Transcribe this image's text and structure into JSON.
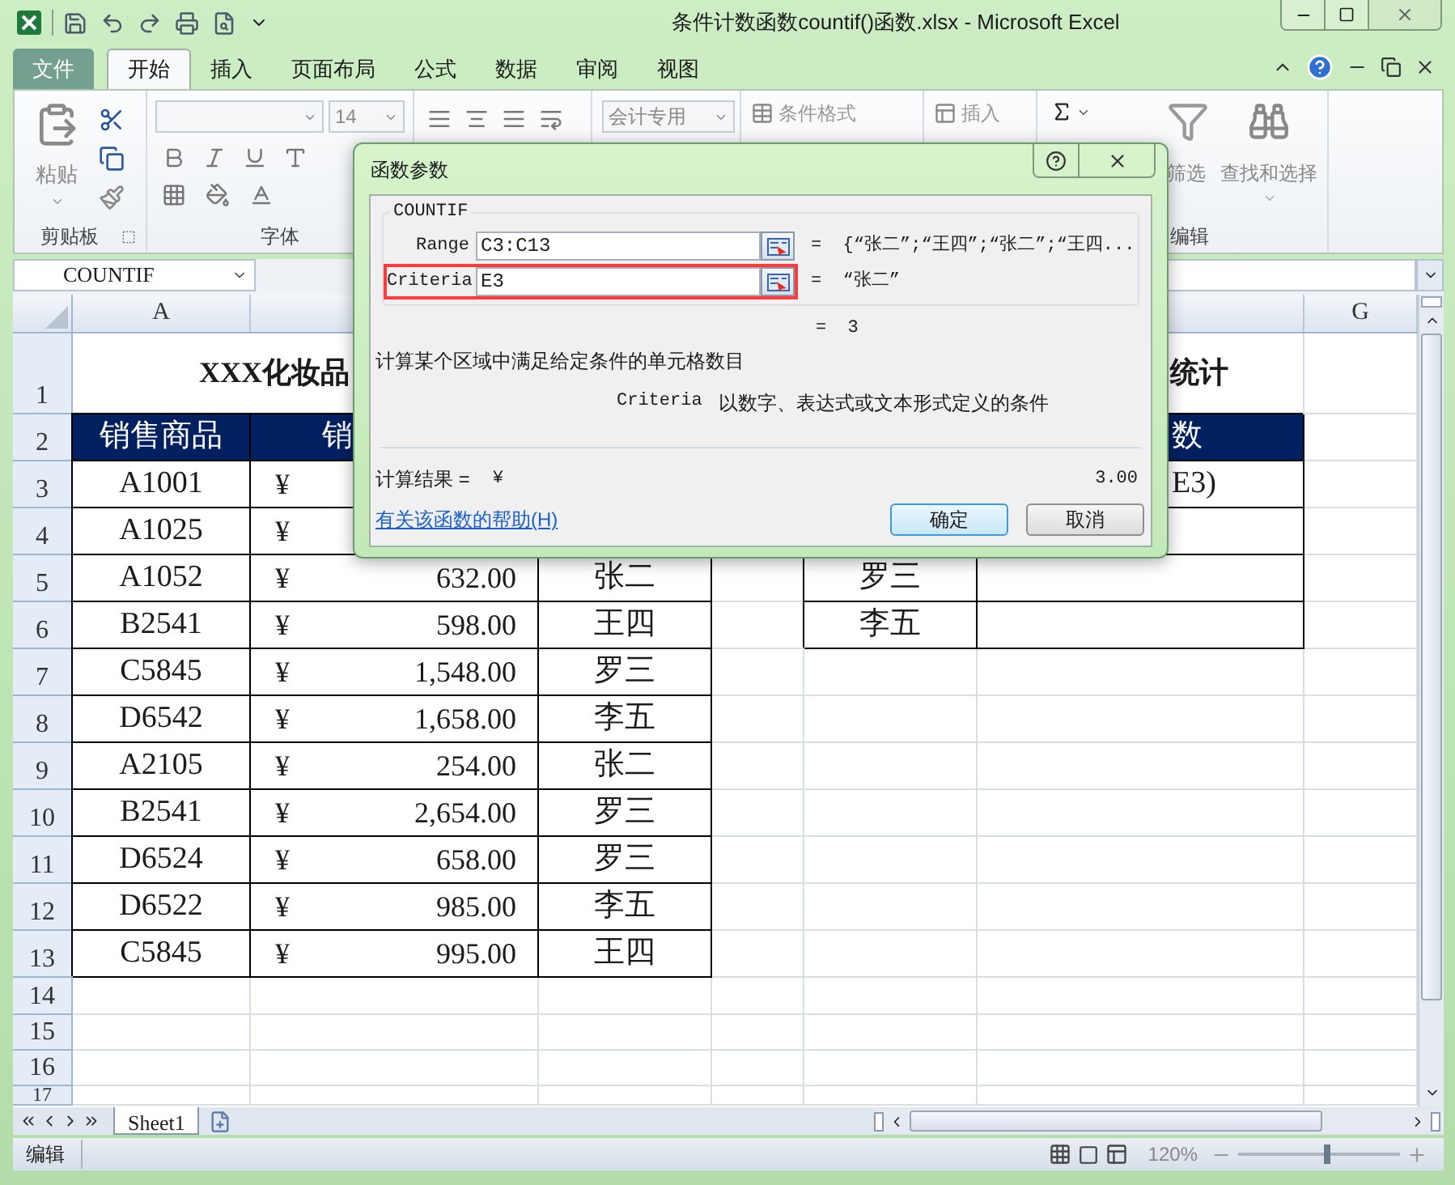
{
  "window": {
    "title": "条件计数函数countif()函数.xlsx  -  Microsoft Excel"
  },
  "ribbon_tabs": [
    {
      "label": "文件",
      "kind": "file",
      "selected": false
    },
    {
      "label": "开始",
      "selected": true
    },
    {
      "label": "插入",
      "selected": false
    },
    {
      "label": "页面布局",
      "selected": false
    },
    {
      "label": "公式",
      "selected": false
    },
    {
      "label": "数据",
      "selected": false
    },
    {
      "label": "审阅",
      "selected": false
    },
    {
      "label": "视图",
      "selected": false
    }
  ],
  "ribbon": {
    "paste_label": "粘贴",
    "clipboard_group": "剪贴板",
    "font_size": "14",
    "font_group": "字体",
    "number_format": "会计专用",
    "conditional_format": "条件格式",
    "insert": "插入",
    "sort_filter": "筛选",
    "find_select": "查找和选择",
    "editing_group": "编辑"
  },
  "formula_bar": {
    "name_box": "COUNTIF"
  },
  "sheet": {
    "column_headers": [
      {
        "label": "A",
        "kind": "first"
      },
      {
        "label": "G",
        "kind": "last"
      }
    ],
    "rows": [
      {
        "number": "1",
        "kind": "title",
        "texts": [
          "XXX化妆品",
          "统计"
        ]
      },
      {
        "number": "2",
        "cells": [
          {
            "text": "销售商品",
            "kind": "header"
          },
          {
            "text": "销",
            "kind": "header"
          },
          null,
          null,
          null,
          {
            "text": "数",
            "kind": "header"
          },
          null
        ]
      },
      {
        "number": "3",
        "cells": [
          {
            "text": "A1001",
            "kind": "text"
          },
          {
            "kind": "currency",
            "symbol": "¥"
          },
          null,
          null,
          null,
          {
            "text": "E3)",
            "kind": "text"
          },
          null
        ]
      },
      {
        "number": "4",
        "cells": [
          {
            "text": "A1025",
            "kind": "text"
          },
          {
            "kind": "currency",
            "symbol": "¥"
          },
          null,
          null,
          null,
          {
            "kind": "text"
          },
          null
        ]
      },
      {
        "number": "5",
        "cells": [
          {
            "text": "A1052",
            "kind": "text"
          },
          {
            "kind": "currency",
            "symbol": "¥",
            "amount": "632.00"
          },
          {
            "text": "张二",
            "kind": "text"
          },
          null,
          {
            "text": "罗三",
            "kind": "text"
          },
          {
            "kind": "text"
          },
          null
        ]
      },
      {
        "number": "6",
        "cells": [
          {
            "text": "B2541",
            "kind": "text"
          },
          {
            "kind": "currency",
            "symbol": "¥",
            "amount": "598.00"
          },
          {
            "text": "王四",
            "kind": "text"
          },
          null,
          {
            "text": "李五",
            "kind": "text"
          },
          {
            "kind": "text"
          },
          null
        ]
      },
      {
        "number": "7",
        "cells": [
          {
            "text": "C5845",
            "kind": "text"
          },
          {
            "kind": "currency",
            "symbol": "¥",
            "amount": "1,548.00"
          },
          {
            "text": "罗三",
            "kind": "text"
          },
          null,
          null,
          null,
          null
        ]
      },
      {
        "number": "8",
        "cells": [
          {
            "text": "D6542",
            "kind": "text"
          },
          {
            "kind": "currency",
            "symbol": "¥",
            "amount": "1,658.00"
          },
          {
            "text": "李五",
            "kind": "text"
          },
          null,
          null,
          null,
          null
        ]
      },
      {
        "number": "9",
        "cells": [
          {
            "text": "A2105",
            "kind": "text"
          },
          {
            "kind": "currency",
            "symbol": "¥",
            "amount": "254.00"
          },
          {
            "text": "张二",
            "kind": "text"
          },
          null,
          null,
          null,
          null
        ]
      },
      {
        "number": "10",
        "cells": [
          {
            "text": "B2541",
            "kind": "text"
          },
          {
            "kind": "currency",
            "symbol": "¥",
            "amount": "2,654.00"
          },
          {
            "text": "罗三",
            "kind": "text"
          },
          null,
          null,
          null,
          null
        ]
      },
      {
        "number": "11",
        "cells": [
          {
            "text": "D6524",
            "kind": "text"
          },
          {
            "kind": "currency",
            "symbol": "¥",
            "amount": "658.00"
          },
          {
            "text": "罗三",
            "kind": "text"
          },
          null,
          null,
          null,
          null
        ]
      },
      {
        "number": "12",
        "cells": [
          {
            "text": "D6522",
            "kind": "text"
          },
          {
            "kind": "currency",
            "symbol": "¥",
            "amount": "985.00"
          },
          {
            "text": "李五",
            "kind": "text"
          },
          null,
          null,
          null,
          null
        ]
      },
      {
        "number": "13",
        "cells": [
          {
            "text": "C5845",
            "kind": "text"
          },
          {
            "kind": "currency",
            "symbol": "¥",
            "amount": "995.00"
          },
          {
            "text": "王四",
            "kind": "text"
          },
          null,
          null,
          null,
          null
        ]
      },
      {
        "number": "14"
      },
      {
        "number": "15"
      },
      {
        "number": "16"
      },
      {
        "number": "17"
      }
    ]
  },
  "sheet_tabs": [
    {
      "label": "Sheet1",
      "selected": true
    }
  ],
  "status_bar": {
    "mode": "编辑",
    "zoom": "120%",
    "zoom_slider": {
      "level": 0.55
    }
  },
  "dialog": {
    "title": "函数参数",
    "function_name": "COUNTIF",
    "arguments": [
      {
        "label": "Range",
        "value": "C3:C13",
        "result": "=  {“张二”;“王四”;“张二”;“王四...",
        "highlighted": false
      },
      {
        "label": "Criteria",
        "value": "E3",
        "result": "=  “张二”",
        "highlighted": true
      }
    ],
    "formula_result": "=  3",
    "description": "计算某个区域中满足给定条件的单元格数目",
    "arg_help_name": "Criteria",
    "arg_help": "以数字、表达式或文本形式定义的条件",
    "calc_result_label": "计算结果 =",
    "calc_result_currency": "¥",
    "calc_result_value": "3.00",
    "help_link": "有关该函数的帮助(H)",
    "buttons": [
      {
        "label": "确定",
        "kind": "primary"
      },
      {
        "label": "取消",
        "kind": "normal"
      }
    ]
  }
}
